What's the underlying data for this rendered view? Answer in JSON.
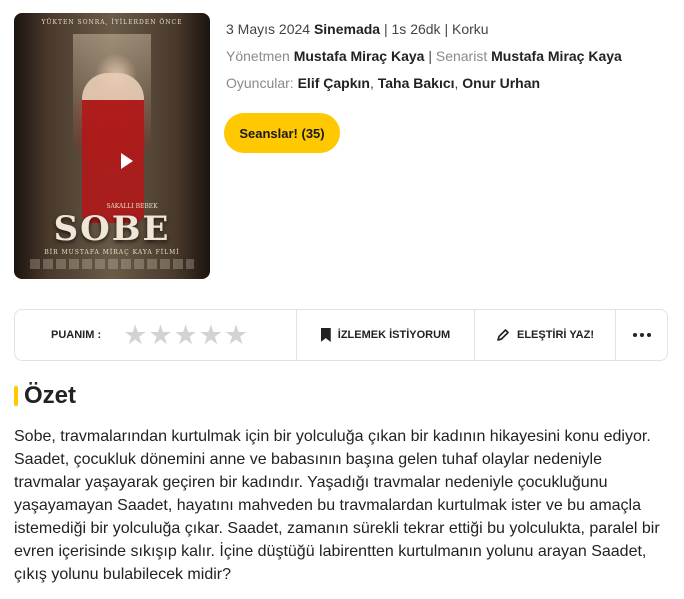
{
  "poster": {
    "tagline": "YÜKTEN SONRA, İYİLERDEN ÖNCE",
    "title": "SOBE",
    "subtitle": "SAKALLI BEBEK",
    "director_line": "BİR MUSTAFA MİRAÇ KAYA FİLMİ"
  },
  "meta": {
    "date": "3 Mayıs 2024",
    "release_type": "Sinemada",
    "separator": " | ",
    "duration": "1s 26dk",
    "genre": "Korku"
  },
  "director": {
    "label": "Yönetmen",
    "name": "Mustafa Miraç Kaya"
  },
  "writer": {
    "label": "Senarist",
    "name": "Mustafa Miraç Kaya"
  },
  "cast": {
    "label": "Oyuncular:",
    "names": [
      "Elif Çapkın",
      "Taha Bakıcı",
      "Onur Urhan"
    ]
  },
  "sessions_button": "Seanslar! (35)",
  "actions": {
    "rating_label": "PUANIM :",
    "stars": 5,
    "rating_value": 0,
    "watchlist_label": "İZLEMEK İSTİYORUM",
    "critique_label": "ELEŞTİRİ YAZ!"
  },
  "summary": {
    "heading": "Özet",
    "text": "Sobe, travmalarından kurtulmak için bir yolculuğa çıkan bir kadının hikayesini konu ediyor. Saadet, çocukluk dönemini anne ve babasının başına gelen tuhaf olaylar nedeniyle travmalar yaşayarak geçiren bir kadındır. Yaşadığı travmalar nedeniyle çocukluğunu yaşayamayan Saadet, hayatını mahveden bu travmalardan kurtulmak ister ve bu amaçla istemediği bir yolculuğa çıkar. Saadet, zamanın sürekli tekrar ettiği bu yolculukta, paralel bir evren içerisinde sıkışıp kalır. İçine düştüğü labirentten kurtulmanın yolunu arayan Saadet, çıkış yolunu bulabilecek midir?"
  },
  "colors": {
    "accent": "#ffc800",
    "star_empty": "#d3d3d3",
    "border": "#e2e2e2"
  }
}
